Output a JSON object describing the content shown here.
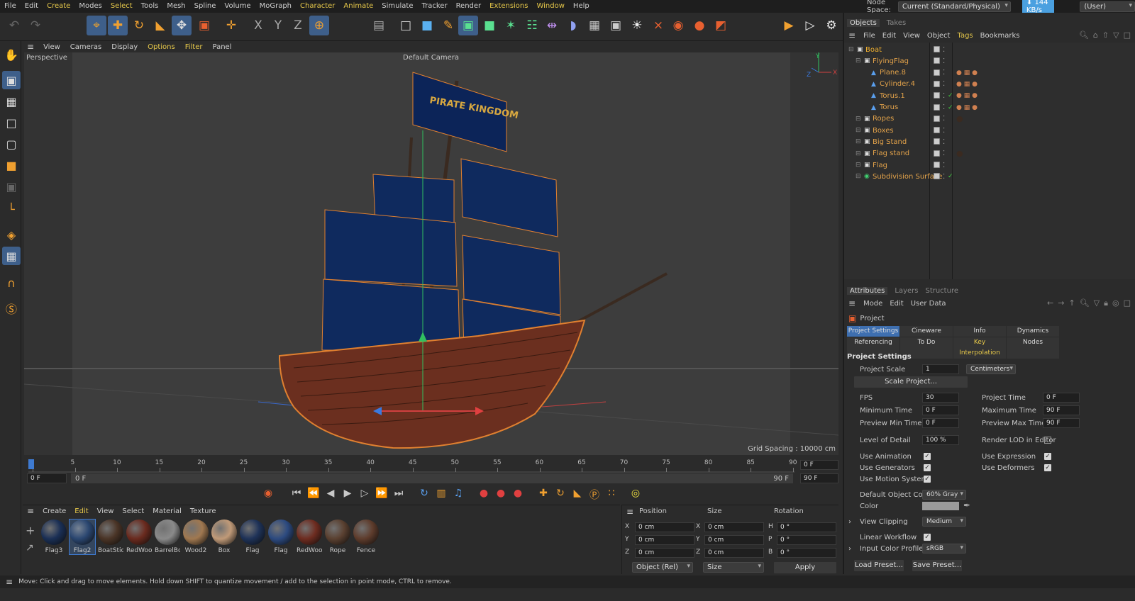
{
  "menubar": {
    "items": [
      "File",
      "Edit",
      "Create",
      "Modes",
      "Select",
      "Tools",
      "Mesh",
      "Spline",
      "Volume",
      "MoGraph",
      "Character",
      "Animate",
      "Simulate",
      "Tracker",
      "Render",
      "Extensions",
      "Window",
      "Help"
    ],
    "highlight": [
      "Create",
      "Select",
      "Character",
      "Animate",
      "Extensions",
      "Window"
    ]
  },
  "nodespace": {
    "label": "Node Space:",
    "value": "Current (Standard/Physical)",
    "speed": "144 KB/s",
    "layout": "(User)"
  },
  "viewport": {
    "menu": [
      "View",
      "Cameras",
      "Display",
      "Options",
      "Filter",
      "Panel"
    ],
    "highlight": [
      "Options",
      "Filter"
    ],
    "name": "Perspective",
    "camera": "Default Camera",
    "grid": "Grid Spacing : 10000 cm",
    "flag_text": "PIRATE KINGDOM"
  },
  "timeline": {
    "ticks": [
      "0",
      "5",
      "10",
      "15",
      "20",
      "25",
      "30",
      "35",
      "40",
      "45",
      "50",
      "55",
      "60",
      "65",
      "70",
      "75",
      "80",
      "85",
      "90"
    ],
    "start": "0 F",
    "range_start": "0 F",
    "range_end": "90 F",
    "frame_cur": "0 F",
    "frame_end": "90 F"
  },
  "materials": {
    "menu": [
      "Create",
      "Edit",
      "View",
      "Select",
      "Material",
      "Texture"
    ],
    "items": [
      {
        "name": "Flag3",
        "color": "#1a2f55"
      },
      {
        "name": "Flag2",
        "color": "#2a4670"
      },
      {
        "name": "BoatStick",
        "color": "#4a3426"
      },
      {
        "name": "RedWood",
        "color": "#6a2a1e"
      },
      {
        "name": "BarrelBo",
        "color": "#8a8a8a"
      },
      {
        "name": "Wood2",
        "color": "#a07850"
      },
      {
        "name": "Box",
        "color": "#c09a78"
      },
      {
        "name": "Flag",
        "color": "#1e3258"
      },
      {
        "name": "Flag",
        "color": "#2c4a80"
      },
      {
        "name": "RedWood",
        "color": "#6e2c20"
      },
      {
        "name": "Rope",
        "color": "#5a4030"
      },
      {
        "name": "Fence",
        "color": "#5e3c2c"
      }
    ]
  },
  "coords": {
    "headers": [
      "Position",
      "Size",
      "Rotation"
    ],
    "rows": [
      {
        "axis": "X",
        "pos": "0 cm",
        "saxis": "X",
        "size": "0 cm",
        "raxis": "H",
        "rot": "0 °"
      },
      {
        "axis": "Y",
        "pos": "0 cm",
        "saxis": "Y",
        "size": "0 cm",
        "raxis": "P",
        "rot": "0 °"
      },
      {
        "axis": "Z",
        "pos": "0 cm",
        "saxis": "Z",
        "size": "0 cm",
        "raxis": "B",
        "rot": "0 °"
      }
    ],
    "mode": "Object (Rel)",
    "size_mode": "Size",
    "apply": "Apply"
  },
  "objects": {
    "tabs": [
      "Objects",
      "Takes"
    ],
    "menu": [
      "File",
      "Edit",
      "View",
      "Object",
      "Tags",
      "Bookmarks"
    ],
    "items": [
      {
        "name": "Boat",
        "indent": 0
      },
      {
        "name": "FlyingFlag",
        "indent": 1
      },
      {
        "name": "Plane.8",
        "indent": 2
      },
      {
        "name": "Cylinder.4",
        "indent": 2
      },
      {
        "name": "Torus.1",
        "indent": 2
      },
      {
        "name": "Torus",
        "indent": 2
      },
      {
        "name": "Ropes",
        "indent": 1
      },
      {
        "name": "Boxes",
        "indent": 1
      },
      {
        "name": "Big Stand",
        "indent": 1
      },
      {
        "name": "Flag stand",
        "indent": 1
      },
      {
        "name": "Flag",
        "indent": 1
      },
      {
        "name": "Subdivision Surface",
        "indent": 1
      }
    ]
  },
  "attributes": {
    "tabs": [
      "Attributes",
      "Layers",
      "Structure"
    ],
    "menu": [
      "Mode",
      "Edit",
      "User Data"
    ],
    "title": "Project",
    "subtabs_row1": [
      "Project Settings",
      "Cineware",
      "Info",
      "Dynamics"
    ],
    "subtabs_row2": [
      "Referencing",
      "To Do",
      "Key Interpolation",
      "Nodes"
    ],
    "section": "Project Settings",
    "project_scale_label": "Project Scale",
    "project_scale": "1",
    "scale_unit": "Centimeters",
    "scale_button": "Scale Project...",
    "fps_label": "FPS",
    "fps": "30",
    "project_time_label": "Project Time",
    "project_time": "0 F",
    "min_time_label": "Minimum Time",
    "min_time": "0 F",
    "max_time_label": "Maximum Time",
    "max_time": "90 F",
    "prev_min_label": "Preview Min Time",
    "prev_min": "0 F",
    "prev_max_label": "Preview Max Time",
    "prev_max": "90 F",
    "lod_label": "Level of Detail",
    "lod": "100 %",
    "render_lod_label": "Render LOD in Editor",
    "use_animation": "Use Animation",
    "use_expression": "Use Expression",
    "use_generators": "Use Generators",
    "use_deformers": "Use Deformers",
    "use_motion": "Use Motion System",
    "default_color_label": "Default Object Color",
    "default_color": "60% Gray",
    "color_label": "Color",
    "view_clip_label": "View Clipping",
    "view_clip": "Medium",
    "linear_label": "Linear Workflow",
    "input_profile_label": "Input Color Profile",
    "input_profile": "sRGB",
    "load_preset": "Load Preset...",
    "save_preset": "Save Preset..."
  },
  "status": "Move: Click and drag to move elements. Hold down SHIFT to quantize movement / add to the selection in point mode, CTRL to remove."
}
